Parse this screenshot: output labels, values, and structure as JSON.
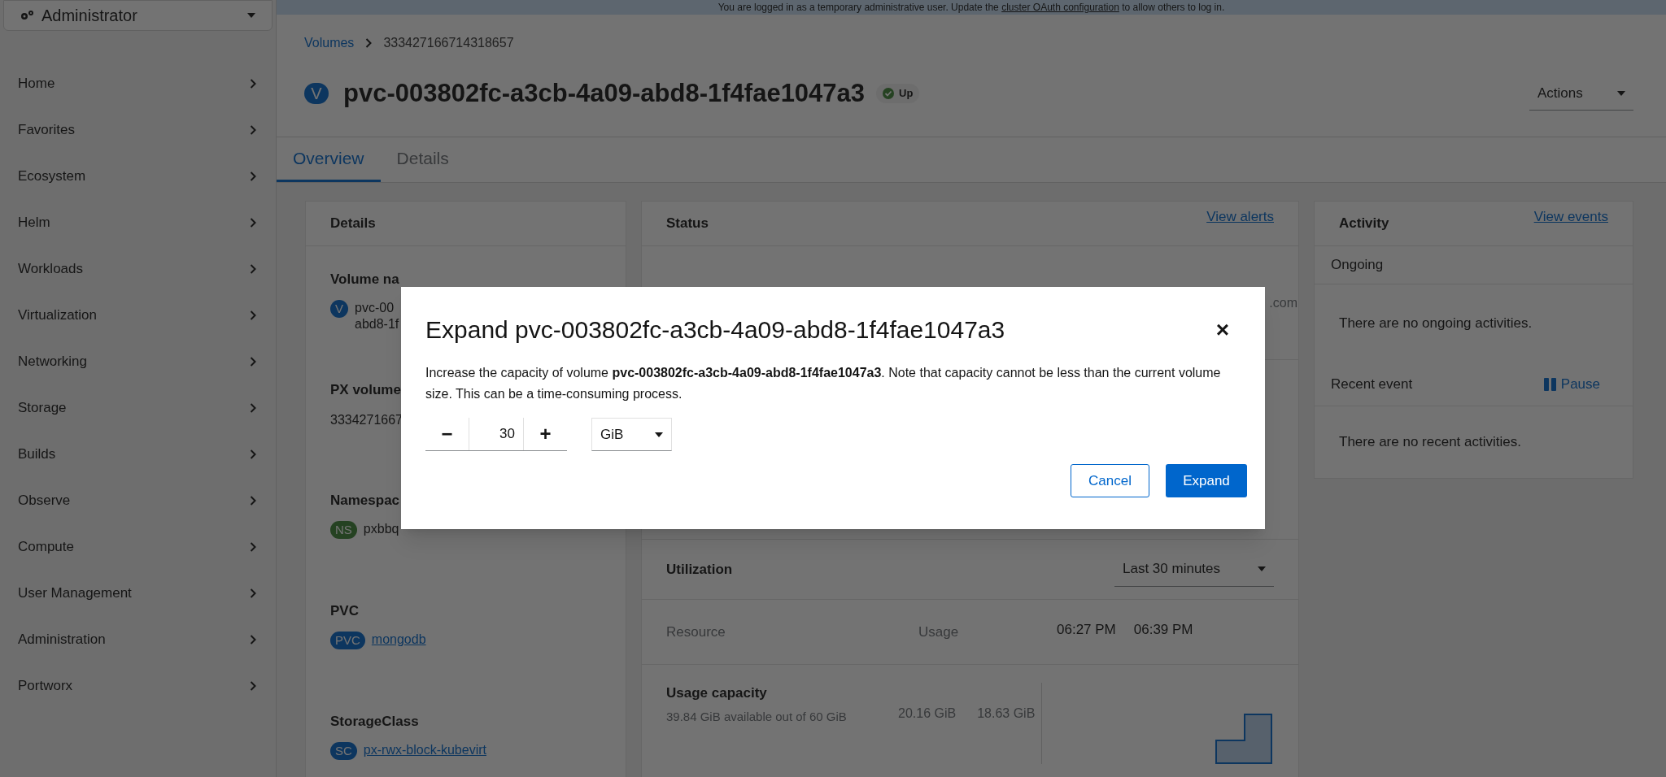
{
  "banner": {
    "text": "You are logged in as a temporary administrative user. Update the ",
    "link": "cluster OAuth configuration",
    "text_end": " to allow others to log in."
  },
  "perspective": {
    "label": "Administrator"
  },
  "nav": [
    {
      "label": "Home",
      "expanded": false
    },
    {
      "label": "Favorites",
      "expanded": false
    },
    {
      "label": "Ecosystem",
      "expanded": false
    },
    {
      "label": "Helm",
      "expanded": false
    },
    {
      "label": "Workloads",
      "expanded": false
    },
    {
      "label": "Virtualization",
      "expanded": false
    },
    {
      "label": "Networking",
      "expanded": false
    },
    {
      "label": "Storage",
      "expanded": false
    },
    {
      "label": "Builds",
      "expanded": false
    },
    {
      "label": "Observe",
      "expanded": false
    },
    {
      "label": "Compute",
      "expanded": false
    },
    {
      "label": "User Management",
      "expanded": false
    },
    {
      "label": "Administration",
      "expanded": false
    },
    {
      "label": "Portworx",
      "expanded": false
    }
  ],
  "breadcrumb": [
    {
      "label": "Volumes",
      "kind": "link"
    },
    {
      "label": "333427166714318657",
      "kind": "current"
    }
  ],
  "header": {
    "badge": "V",
    "title": "pvc-003802fc-a3cb-4a09-abd8-1f4fae1047a3",
    "status": "Up",
    "actions": "Actions"
  },
  "tabs": [
    {
      "label": "Overview",
      "selected": true
    },
    {
      "label": "Details",
      "selected": false
    }
  ],
  "details_card": {
    "title": "Details",
    "fields": [
      {
        "label": "Volume na",
        "kind": "resource",
        "badge": "V",
        "link": false,
        "values": [
          "pvc-00",
          "abd8-1f"
        ]
      },
      {
        "label": "PX volume",
        "kind": "text",
        "values": [
          "3334271667"
        ]
      },
      {
        "label": "Namespac",
        "kind": "namespace",
        "badge": "NS",
        "link": false,
        "values": [
          "pxbbq"
        ]
      },
      {
        "label": "PVC",
        "kind": "resource",
        "badge": "PVC",
        "link": true,
        "values": [
          "mongodb"
        ]
      },
      {
        "label": "StorageClass",
        "kind": "resource",
        "badge": "SC",
        "link": true,
        "values": [
          "px-rwx-block-kubevirt"
        ]
      }
    ]
  },
  "status_card": {
    "title": "Status",
    "link": "View alerts",
    "fragment": ".com"
  },
  "utilization": {
    "title": "Utilization",
    "range": "Last 30 minutes",
    "columns": [
      "Resource",
      "Usage"
    ],
    "times": [
      "06:27 PM",
      "06:39 PM"
    ],
    "rows": [
      {
        "name": "Usage capacity",
        "detail": "39.84 GiB available out of 60 GiB",
        "usage": "20.16 GiB",
        "axis_label": "18.63 GiB"
      }
    ]
  },
  "activity_card": {
    "title": "Activity",
    "link": "View events",
    "ongoing_title": "Ongoing",
    "ongoing_empty": "There are no ongoing activities.",
    "recent_title": "Recent event",
    "pause": "Pause",
    "recent_empty": "There are no recent activities."
  },
  "modal": {
    "title": "Expand pvc-003802fc-a3cb-4a09-abd8-1f4fae1047a3",
    "description": "Increase the capacity of volume **pvc-003802fc-a3cb-4a09-abd8-1f4fae1047a3**. Note that capacity cannot be less than the current volume size. This can be a time-consuming process.",
    "minus": "−",
    "value": "30",
    "plus": "+",
    "unit": "GiB",
    "close": "×",
    "cancel": "Cancel",
    "confirm": "Expand"
  }
}
